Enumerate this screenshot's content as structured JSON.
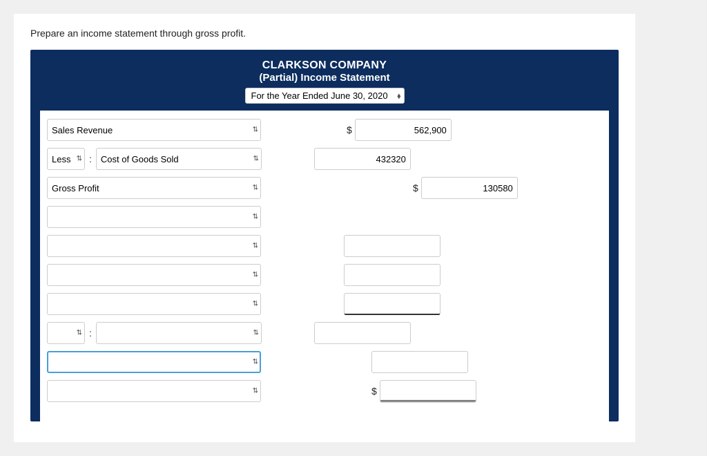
{
  "instructions": "Prepare an income statement through gross profit.",
  "header": {
    "company": "CLARKSON COMPANY",
    "statement": "(Partial) Income Statement",
    "year_label": "For the Year Ended June 30, 2020"
  },
  "rows": {
    "sales_revenue_label": "Sales Revenue",
    "less_label": "Less",
    "colon": ":",
    "cogs_label": "Cost of Goods Sold",
    "gross_profit_label": "Gross Profit",
    "sales_dollar": "$",
    "sales_amount": "562,900",
    "cogs_amount": "432320",
    "gross_dollar": "$",
    "gross_amount": "130580"
  },
  "selects": {
    "year_options": [
      "For the Year Ended June 30, 2020"
    ],
    "empty_label": ""
  }
}
